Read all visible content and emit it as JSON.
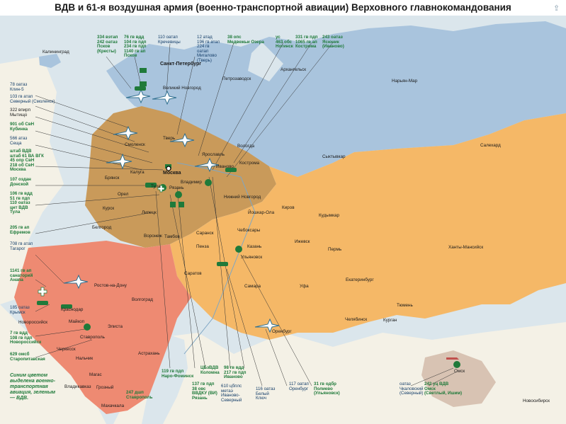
{
  "title": "ВДВ и 61-я воздушная армия (военно-транспортной авиации) Верховного главнокомандования",
  "colors": {
    "sea": "#dbe6ec",
    "north_district": "#a9c4dd",
    "center_district": "#c99a5a",
    "south_district": "#ee8a72",
    "volga_district": "#f5b867",
    "siberia_district": "#d8c3b3",
    "foreign": "#f4f1e6",
    "unit_green": "#1f7a3a",
    "aircraft_blue": "#2f6f8f"
  },
  "note": "Синим цветом выделена военно-транспортная авиация, зеленым — ВДВ.",
  "cities": [
    "Калининград",
    "Санкт-Петербург",
    "Великий Новгород",
    "Петрозаводск",
    "Архангельск",
    "Нарьян-Мар",
    "Смоленск",
    "Тверь",
    "Вологда",
    "Ярославль",
    "Кострома",
    "Иваново",
    "Москва",
    "Калуга",
    "Тула",
    "Брянск",
    "Орел",
    "Рязань",
    "Владимир",
    "Нижний Новгород",
    "Курск",
    "Липецк",
    "Белгород",
    "Воронеж",
    "Тамбов",
    "Сыктывкар",
    "Салехард",
    "Киров",
    "Кудымкар",
    "Йошкар-Ола",
    "Чебоксары",
    "Саранск",
    "Пенза",
    "Казань",
    "Ижевск",
    "Пермь",
    "Ханты-Мансийск",
    "Ульяновск",
    "Саратов",
    "Самара",
    "Уфа",
    "Екатеринбург",
    "Тюмень",
    "Челябинск",
    "Курган",
    "Оренбург",
    "Ростов-на-Дону",
    "Волгоград",
    "Краснодар",
    "Майкоп",
    "Новороссийск",
    "Элиста",
    "Ставрополь",
    "Черкесск",
    "Нальчик",
    "Астрахань",
    "Магас",
    "Владикавказ",
    "Грозный",
    "Махачкала",
    "Омск",
    "Новосибирск"
  ],
  "units_top": [
    "334 вэтап\n242 оатаз\nПсков\n(Кресты)",
    "76 гв вдд\n104 гв пдп\n234 гв пдп\n1140 гв ап\nПсков",
    "110 оатап\nКречевицы",
    "12 атад\n196 гв атап\n224 гв\nоатап\nМигалово\n(Тверь)",
    "38 опс\nМедвежьи Озера",
    "ус\n463 обс\nНогинск",
    "331 гв пдп\n1065 гв ап\nКострома",
    "243 оатаз\nЯсюник\n(Иваново)"
  ],
  "units_left": [
    "78 оатаз\nКлин-5",
    "103 гв атап\nСеверный (Смоленск)",
    "322 впирп\nМытищо",
    "901 об СвН\nКубинка",
    "566 атаз\nСеща",
    "штаб ВДВ\nштаб 61 ВА ВГК\n45 опр СвН\n218 об СвН\nМосква",
    "107 оздан\nДонской",
    "106 гв вдд\n51 гв пдп\n110 оатаз\nцнт ВДВ\nТула",
    "205 гв ап\nЕфремов",
    "708 гв атап\nТагарог",
    "1141 гв ап\nсанаторий\nАнапа",
    "185 оатаз\nКрымск",
    "7 гв вдд\n108 гв пдп\nНовороссийск",
    "629 омсб\nСтаропитавская"
  ],
  "units_bottom": [
    "119 гв пдп\nНаро-Фоминск",
    "137 гв пдп\n38 овс\nВВДКУ (ВИ)\nРязань",
    "ЦБзВДВ\nКоломна",
    "98 гв вдд\n217 гв пдп\nИваново",
    "610 цбплс\nметаэ\nИваново-\nСеверный",
    "116 оатаз\nБелый\nКлюч",
    "117 оатап\nОренбург",
    "31 гв одбр\nПолиево\n(Ульяновск)",
    "247 дшп\nСтаврополь",
    "оатаз\nЧкаловский\n(Северный)",
    "242 уц ВДВ\nОмск\n(Светлый, Ишим)"
  ]
}
